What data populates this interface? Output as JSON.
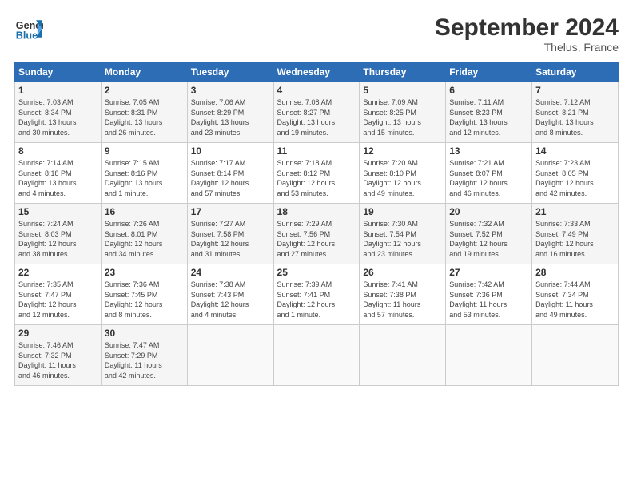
{
  "header": {
    "logo_general": "General",
    "logo_blue": "Blue",
    "month_title": "September 2024",
    "location": "Thelus, France"
  },
  "calendar": {
    "days_of_week": [
      "Sunday",
      "Monday",
      "Tuesday",
      "Wednesday",
      "Thursday",
      "Friday",
      "Saturday"
    ],
    "weeks": [
      [
        {
          "day": "",
          "info": ""
        },
        {
          "day": "2",
          "info": "Sunrise: 7:05 AM\nSunset: 8:31 PM\nDaylight: 13 hours\nand 26 minutes."
        },
        {
          "day": "3",
          "info": "Sunrise: 7:06 AM\nSunset: 8:29 PM\nDaylight: 13 hours\nand 23 minutes."
        },
        {
          "day": "4",
          "info": "Sunrise: 7:08 AM\nSunset: 8:27 PM\nDaylight: 13 hours\nand 19 minutes."
        },
        {
          "day": "5",
          "info": "Sunrise: 7:09 AM\nSunset: 8:25 PM\nDaylight: 13 hours\nand 15 minutes."
        },
        {
          "day": "6",
          "info": "Sunrise: 7:11 AM\nSunset: 8:23 PM\nDaylight: 13 hours\nand 12 minutes."
        },
        {
          "day": "7",
          "info": "Sunrise: 7:12 AM\nSunset: 8:21 PM\nDaylight: 13 hours\nand 8 minutes."
        }
      ],
      [
        {
          "day": "1",
          "info": "Sunrise: 7:03 AM\nSunset: 8:34 PM\nDaylight: 13 hours\nand 30 minutes."
        },
        {
          "day": "8",
          "info": "Sunrise: 7:14 AM\nSunset: 8:18 PM\nDaylight: 13 hours\nand 4 minutes."
        },
        {
          "day": "9",
          "info": "Sunrise: 7:15 AM\nSunset: 8:16 PM\nDaylight: 13 hours\nand 1 minute."
        },
        {
          "day": "10",
          "info": "Sunrise: 7:17 AM\nSunset: 8:14 PM\nDaylight: 12 hours\nand 57 minutes."
        },
        {
          "day": "11",
          "info": "Sunrise: 7:18 AM\nSunset: 8:12 PM\nDaylight: 12 hours\nand 53 minutes."
        },
        {
          "day": "12",
          "info": "Sunrise: 7:20 AM\nSunset: 8:10 PM\nDaylight: 12 hours\nand 49 minutes."
        },
        {
          "day": "13",
          "info": "Sunrise: 7:21 AM\nSunset: 8:07 PM\nDaylight: 12 hours\nand 46 minutes."
        },
        {
          "day": "14",
          "info": "Sunrise: 7:23 AM\nSunset: 8:05 PM\nDaylight: 12 hours\nand 42 minutes."
        }
      ],
      [
        {
          "day": "15",
          "info": "Sunrise: 7:24 AM\nSunset: 8:03 PM\nDaylight: 12 hours\nand 38 minutes."
        },
        {
          "day": "16",
          "info": "Sunrise: 7:26 AM\nSunset: 8:01 PM\nDaylight: 12 hours\nand 34 minutes."
        },
        {
          "day": "17",
          "info": "Sunrise: 7:27 AM\nSunset: 7:58 PM\nDaylight: 12 hours\nand 31 minutes."
        },
        {
          "day": "18",
          "info": "Sunrise: 7:29 AM\nSunset: 7:56 PM\nDaylight: 12 hours\nand 27 minutes."
        },
        {
          "day": "19",
          "info": "Sunrise: 7:30 AM\nSunset: 7:54 PM\nDaylight: 12 hours\nand 23 minutes."
        },
        {
          "day": "20",
          "info": "Sunrise: 7:32 AM\nSunset: 7:52 PM\nDaylight: 12 hours\nand 19 minutes."
        },
        {
          "day": "21",
          "info": "Sunrise: 7:33 AM\nSunset: 7:49 PM\nDaylight: 12 hours\nand 16 minutes."
        }
      ],
      [
        {
          "day": "22",
          "info": "Sunrise: 7:35 AM\nSunset: 7:47 PM\nDaylight: 12 hours\nand 12 minutes."
        },
        {
          "day": "23",
          "info": "Sunrise: 7:36 AM\nSunset: 7:45 PM\nDaylight: 12 hours\nand 8 minutes."
        },
        {
          "day": "24",
          "info": "Sunrise: 7:38 AM\nSunset: 7:43 PM\nDaylight: 12 hours\nand 4 minutes."
        },
        {
          "day": "25",
          "info": "Sunrise: 7:39 AM\nSunset: 7:41 PM\nDaylight: 12 hours\nand 1 minute."
        },
        {
          "day": "26",
          "info": "Sunrise: 7:41 AM\nSunset: 7:38 PM\nDaylight: 11 hours\nand 57 minutes."
        },
        {
          "day": "27",
          "info": "Sunrise: 7:42 AM\nSunset: 7:36 PM\nDaylight: 11 hours\nand 53 minutes."
        },
        {
          "day": "28",
          "info": "Sunrise: 7:44 AM\nSunset: 7:34 PM\nDaylight: 11 hours\nand 49 minutes."
        }
      ],
      [
        {
          "day": "29",
          "info": "Sunrise: 7:46 AM\nSunset: 7:32 PM\nDaylight: 11 hours\nand 46 minutes."
        },
        {
          "day": "30",
          "info": "Sunrise: 7:47 AM\nSunset: 7:29 PM\nDaylight: 11 hours\nand 42 minutes."
        },
        {
          "day": "",
          "info": ""
        },
        {
          "day": "",
          "info": ""
        },
        {
          "day": "",
          "info": ""
        },
        {
          "day": "",
          "info": ""
        },
        {
          "day": "",
          "info": ""
        }
      ]
    ]
  }
}
